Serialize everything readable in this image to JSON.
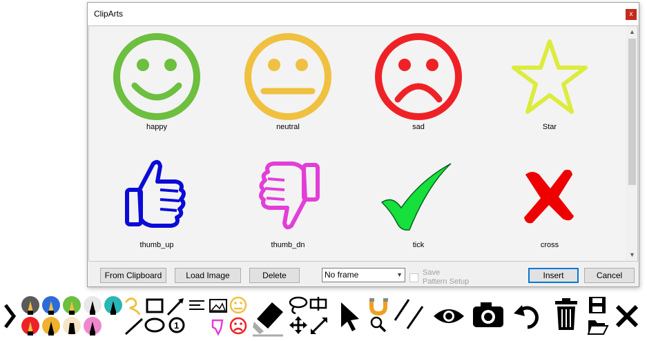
{
  "dialog": {
    "title": "ClipArts",
    "close_glyph": "x",
    "clips": [
      {
        "label": "happy",
        "icon": "happy-face-icon",
        "color": "#6cbf3f"
      },
      {
        "label": "neutral",
        "icon": "neutral-face-icon",
        "color": "#f0c040"
      },
      {
        "label": "sad",
        "icon": "sad-face-icon",
        "color": "#ee2226"
      },
      {
        "label": "Star",
        "icon": "star-icon",
        "color": "#dcec3c"
      },
      {
        "label": "thumb_up",
        "icon": "thumb-up-icon",
        "color": "#0b0bd8"
      },
      {
        "label": "thumb_dn",
        "icon": "thumb-down-icon",
        "color": "#e23ed8"
      },
      {
        "label": "tick",
        "icon": "tick-icon",
        "color": "#16e03c"
      },
      {
        "label": "cross",
        "icon": "cross-icon",
        "color": "#ee0000"
      }
    ],
    "buttons": {
      "from_clipboard": "From Clipboard",
      "load_image": "Load Image",
      "delete": "Delete",
      "insert": "Insert",
      "cancel": "Cancel"
    },
    "frame_select": {
      "value": "No frame"
    },
    "save_pattern": {
      "line1": "Save",
      "line2": "Pattern Setup",
      "checked": false
    }
  },
  "toolbar": {
    "tools": [
      "chevron-right-icon",
      "pen-dark-gray-icon",
      "pen-blue-icon",
      "pen-green-icon",
      "pen-white-icon",
      "pen-teal-icon",
      "pen-red-icon",
      "pen-orange-icon",
      "highlighter-beige-icon",
      "pen-pink-icon",
      "freehand-icon",
      "line-icon",
      "rectangle-icon",
      "ellipse-icon",
      "arrow-icon",
      "numbered-marker-icon",
      "text-icon",
      "image-icon",
      "clipart-smiley-icon",
      "clipart-thumb-icon",
      "clipart-sad-icon",
      "eraser-icon",
      "lasso-icon",
      "move-icon",
      "resize-icon",
      "select-pointer-icon",
      "magnet-icon",
      "zoom-icon",
      "parallel-lines-icon",
      "eye-icon",
      "camera-icon",
      "undo-icon",
      "trash-icon",
      "save-icon",
      "open-folder-icon",
      "close-x-icon"
    ]
  }
}
